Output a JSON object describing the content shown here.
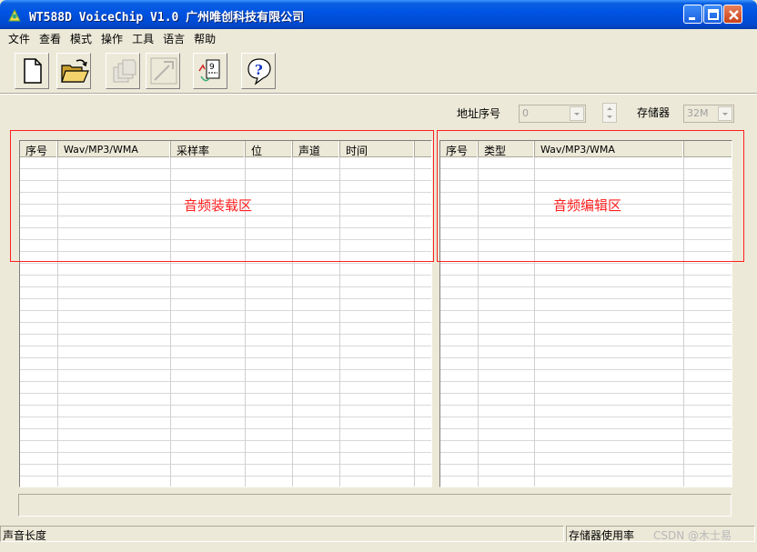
{
  "window": {
    "title": "WT588D VoiceChip V1.0 广州唯创科技有限公司"
  },
  "menu": [
    "文件",
    "查看",
    "模式",
    "操作",
    "工具",
    "语言",
    "帮助"
  ],
  "toolbar": {
    "buttons": [
      {
        "icon": "new-file-icon",
        "enabled": true
      },
      {
        "icon": "open-folder-icon",
        "enabled": true
      },
      {
        "icon": "copy-pages-icon",
        "enabled": false
      },
      {
        "icon": "build-hammer-icon",
        "enabled": false
      },
      {
        "icon": "chart-edit-icon",
        "enabled": true
      },
      {
        "icon": "help-icon",
        "enabled": true
      }
    ]
  },
  "controls": {
    "address_label": "地址序号",
    "address_value": "0",
    "storage_label": "存储器",
    "storage_value": "32M"
  },
  "load_list": {
    "columns": [
      "序号",
      "Wav/MP3/WMA",
      "采样率",
      "位",
      "声道",
      "时间"
    ],
    "rows": []
  },
  "edit_list": {
    "columns": [
      "序号",
      "类型",
      "Wav/MP3/WMA"
    ],
    "rows": []
  },
  "annotations": {
    "load_region": "音频装载区",
    "edit_region": "音频编辑区"
  },
  "statusbar": {
    "sound_length_label": "声音长度",
    "memory_usage_label": "存储器使用率"
  },
  "watermark": "CSDN @木士易",
  "colors": {
    "titlebar": "#0054e3",
    "window_bg": "#ece9d8",
    "annotation": "#ff2020"
  }
}
